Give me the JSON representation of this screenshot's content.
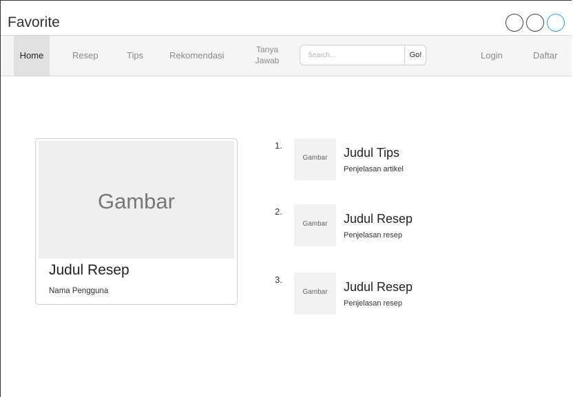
{
  "app": {
    "title": "Favorite"
  },
  "nav": {
    "home": "Home",
    "resep": "Resep",
    "tips": "Tips",
    "rekomendasi": "Rekomendasi",
    "tanya_line1": "Tanya",
    "tanya_line2": "Jawab",
    "search_placeholder": "Search...",
    "search_button": "Go!",
    "login": "Login",
    "daftar": "Daftar"
  },
  "featured": {
    "image_label": "Gambar",
    "title": "Judul Resep",
    "author": "Nama Pengguna"
  },
  "list": [
    {
      "number": "1.",
      "image_label": "Gambar",
      "title": "Judul Tips",
      "subtitle": "Penjelasan artikel"
    },
    {
      "number": "2.",
      "image_label": "Gambar",
      "title": "Judul Resep",
      "subtitle": "Penjelasan resep"
    },
    {
      "number": "3.",
      "image_label": "Gambar",
      "title": "Judul Resep",
      "subtitle": "Penjelasan resep"
    }
  ],
  "colors": {
    "accent_circle": "#2aa3f4",
    "nav_bg": "#f5f5f5",
    "nav_active_bg": "#e1e1e1"
  }
}
